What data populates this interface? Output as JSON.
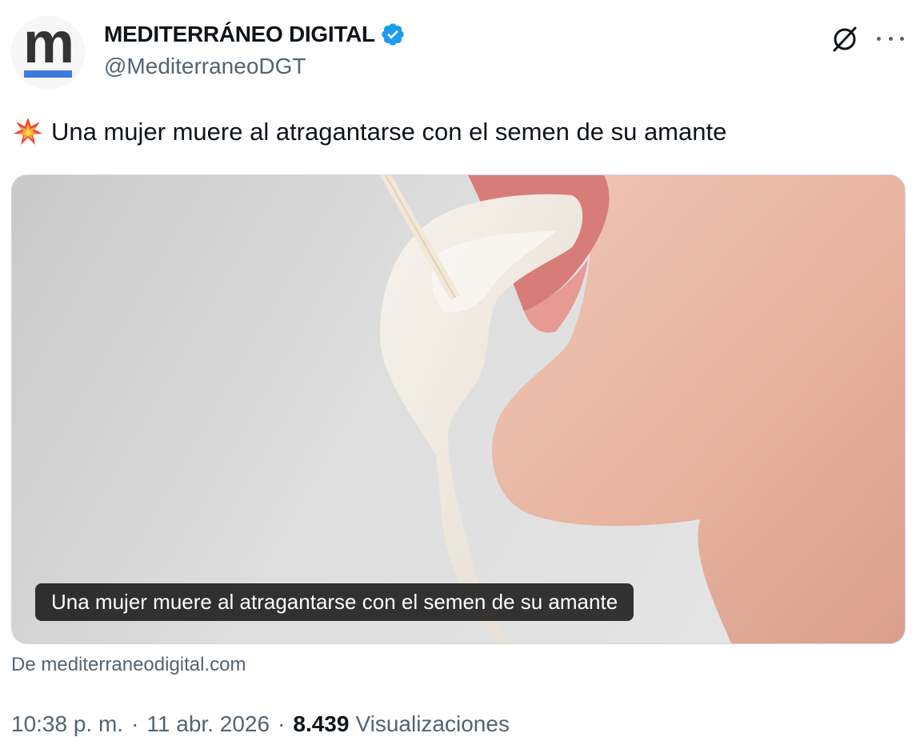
{
  "author": {
    "display_name": "MEDITERRÁNEO DIGITAL",
    "handle": "@MediterraneoDGT",
    "avatar_letter": "m",
    "verified": true,
    "verified_color": "#1d9bf0",
    "avatar_bar_color": "#3d7ae0"
  },
  "tweet": {
    "emoji_icon": "collision-icon",
    "text": "Una mujer muere al atragantarse con el semen de su amante"
  },
  "card": {
    "caption": "Una mujer muere al atragantarse con el semen de su amante",
    "source": "De mediterraneodigital.com"
  },
  "meta": {
    "time": "10:38 p. m.",
    "separator": "·",
    "date": "11 abr. 2026",
    "views_count": "8.439",
    "views_label": "Visualizaciones"
  },
  "colors": {
    "text_primary": "#0f1419",
    "text_secondary": "#536471",
    "border": "#cfd9de"
  }
}
